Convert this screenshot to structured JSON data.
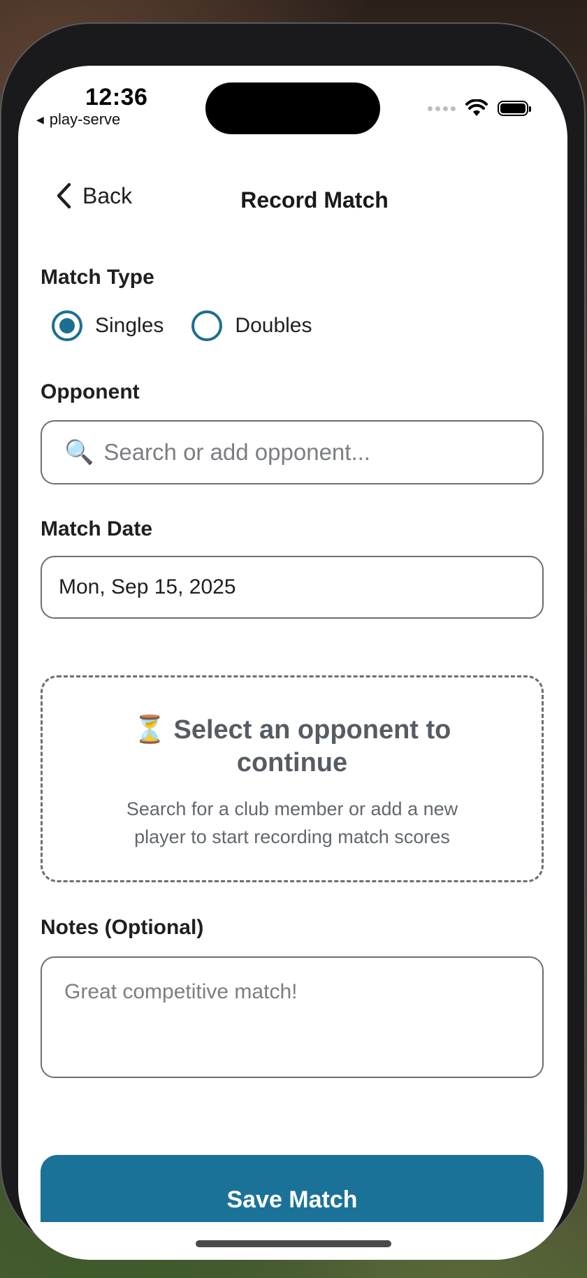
{
  "status_bar": {
    "time": "12:36",
    "back_app": "play-serve",
    "icons": [
      "signal-dots-icon",
      "wifi-icon",
      "battery-icon"
    ]
  },
  "header": {
    "back_label": "Back",
    "title": "Record Match"
  },
  "match_type": {
    "label": "Match Type",
    "options": [
      "Singles",
      "Doubles"
    ],
    "selected": "Singles"
  },
  "opponent": {
    "label": "Opponent",
    "search_placeholder": "Search or add opponent...",
    "search_icon": "🔍"
  },
  "match_date": {
    "label": "Match Date",
    "value": "Mon, Sep 15, 2025"
  },
  "empty_state": {
    "icon": "⏳",
    "title": "Select an opponent to continue",
    "body": "Search for a club member or add a new player to start recording match scores"
  },
  "notes": {
    "label": "Notes (Optional)",
    "placeholder": "Great competitive match!"
  },
  "actions": {
    "save_label": "Save Match"
  },
  "colors": {
    "accent": "#1b7298",
    "radio": "#1d6f91"
  }
}
